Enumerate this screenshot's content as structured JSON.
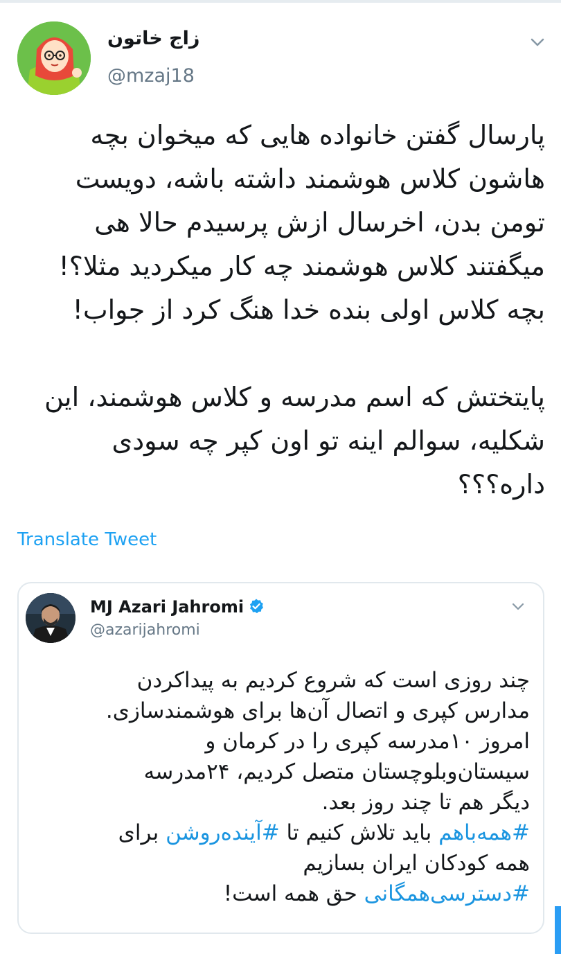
{
  "tweet": {
    "author_name": "زاج خاتون",
    "author_handle": "@mzaj18",
    "avatar_icon": "cartoon-avatar-icon",
    "menu_icon": "chevron-down-icon",
    "paragraph1": "پارسال گفتن خانواده هایی که میخوان بچه هاشون کلاس هوشمند داشته باشه، دویست تومن بدن، اخرسال ازش پرسیدم حالا هی میگفتند کلاس هوشمند چه کار میکردید مثلا؟! بچه کلاس اولی  بنده خدا هنگ کرد از جواب!",
    "paragraph2": "پایتختش که اسم مدرسه و کلاس هوشمند، این شکلیه، سوالم اینه تو اون کپر چه سودی داره؟؟؟",
    "translate_label": "Translate Tweet"
  },
  "quoted_tweet": {
    "author_name": "MJ Azari Jahromi",
    "author_handle": "@azarijahromi",
    "verified_icon": "verified-badge-icon",
    "menu_icon": "chevron-down-icon",
    "lines": {
      "l1": "چند روزی است که شروع کردیم به پیداکردن",
      "l2": "مدارس کپری و اتصال آن‌ها برای هوشمندسازی.",
      "l3": "امروز ۱۰مدرسه کپری را در کرمان و",
      "l4": "سیستان‌وبلوچستان متصل کردیم، ۲۴مدرسه",
      "l5": "دیگر هم تا چند روز بعد.",
      "l6_tag1": "#همه‌باهم",
      "l6_mid": " باید تلاش کنیم تا ",
      "l6_tag2": "#آینده‌روشن",
      "l6_end": " برای",
      "l7": "همه کودکان ایران بسازیم",
      "l8_tag": "#دسترسی‌همگانی",
      "l8_end": " حق همه است!"
    }
  },
  "colors": {
    "link": "#1da1f2",
    "hashtag": "#1b95e0",
    "secondary_text": "#657786",
    "border": "#e1e8ed",
    "verified": "#1da1f2"
  }
}
